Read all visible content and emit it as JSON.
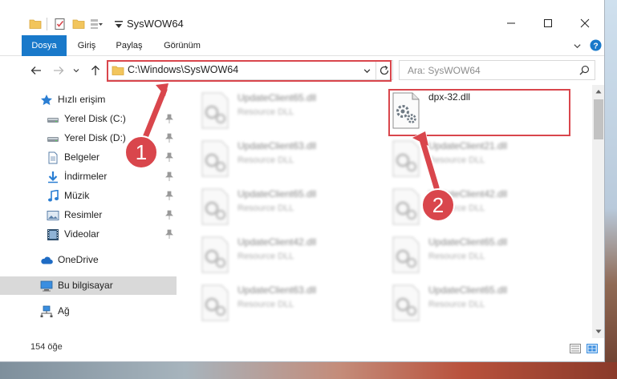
{
  "window": {
    "title": "SysWOW64",
    "controls": [
      "minimize",
      "maximize",
      "close"
    ]
  },
  "ribbon": {
    "tabs": [
      "Dosya",
      "Giriş",
      "Paylaş",
      "Görünüm"
    ],
    "active_tab": "Dosya",
    "accent_color": "#1979ca"
  },
  "address": {
    "path": "C:\\Windows\\SysWOW64",
    "search_placeholder": "Ara: SysWOW64"
  },
  "sidebar": {
    "items": [
      {
        "label": "Hızlı erişim",
        "icon": "star-icon",
        "pinned": false
      },
      {
        "label": "Yerel Disk (C:)",
        "icon": "drive-icon",
        "pinned": true
      },
      {
        "label": "Yerel Disk (D:)",
        "icon": "drive-icon",
        "pinned": true
      },
      {
        "label": "Belgeler",
        "icon": "documents-icon",
        "pinned": true
      },
      {
        "label": "İndirmeler",
        "icon": "download-icon",
        "pinned": true
      },
      {
        "label": "Müzik",
        "icon": "music-icon",
        "pinned": true
      },
      {
        "label": "Resimler",
        "icon": "pictures-icon",
        "pinned": true
      },
      {
        "label": "Videolar",
        "icon": "videos-icon",
        "pinned": true
      },
      {
        "label": "OneDrive",
        "icon": "cloud-icon",
        "pinned": false
      },
      {
        "label": "Bu bilgisayar",
        "icon": "computer-icon",
        "pinned": false,
        "selected": true
      },
      {
        "label": "Ağ",
        "icon": "network-icon",
        "pinned": false
      }
    ]
  },
  "files": {
    "type_label": "Resource DLL",
    "target": {
      "name": "dpx-32.dll"
    },
    "left_column": [
      "UpdateClient65.dll",
      "UpdateClient63.dll",
      "UpdateClient65.dll",
      "UpdateClient42.dll",
      "UpdateClient63.dll"
    ],
    "right_column": [
      "UpdateClient21.dll",
      "UpdateClient42.dll",
      "UpdateClient65.dll",
      "UpdateClient65.dll"
    ]
  },
  "status": {
    "item_count": "154 öğe"
  },
  "callouts": {
    "step1": "1",
    "step2": "2",
    "color": "#d9464c"
  }
}
